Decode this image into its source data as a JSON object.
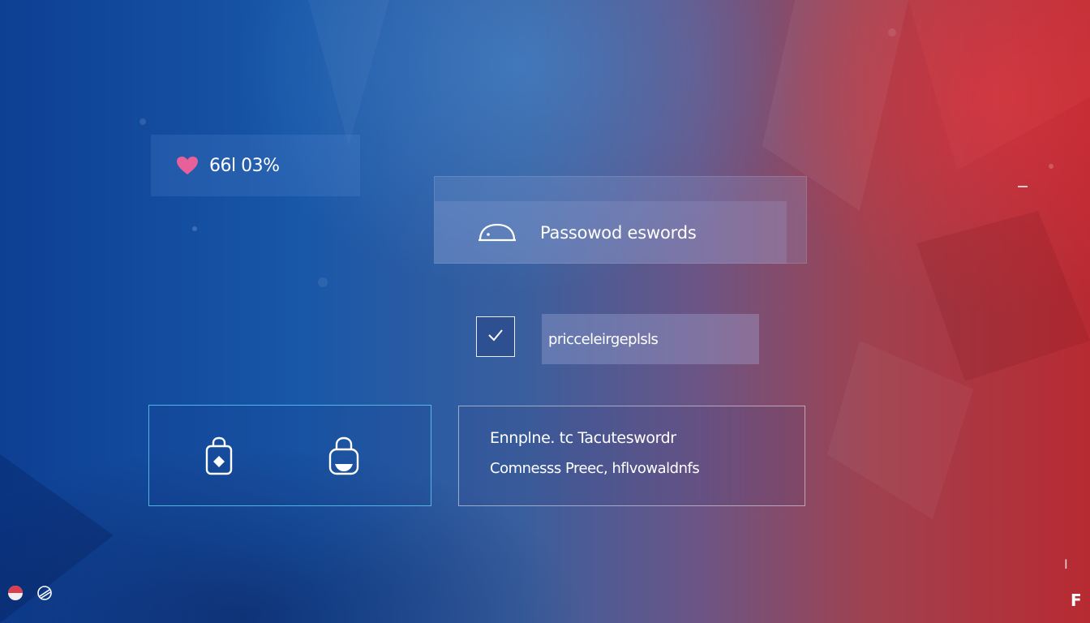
{
  "stat_card": {
    "icon": "heart-icon",
    "value": "66l 03%"
  },
  "password_card": {
    "icon": "lock-shackle-icon",
    "label": "Passowod eswords"
  },
  "checkbox_row": {
    "checked": true,
    "input_value": "pricceleirgeplsls"
  },
  "icon_card": {
    "icons": [
      "diamond-lock-icon",
      "padlock-icon"
    ]
  },
  "info_card": {
    "line1": "Ennplne. tc Tacuteswordr",
    "line2": "Comnesss Preec, hflvowaldnfs"
  },
  "corner": {
    "right_top": "I",
    "right_bottom": "F"
  },
  "colors": {
    "heart": "#e8609a",
    "card_border": "#5ac8f0",
    "accent_blue": "#1957a8",
    "accent_red": "#b82a32"
  }
}
